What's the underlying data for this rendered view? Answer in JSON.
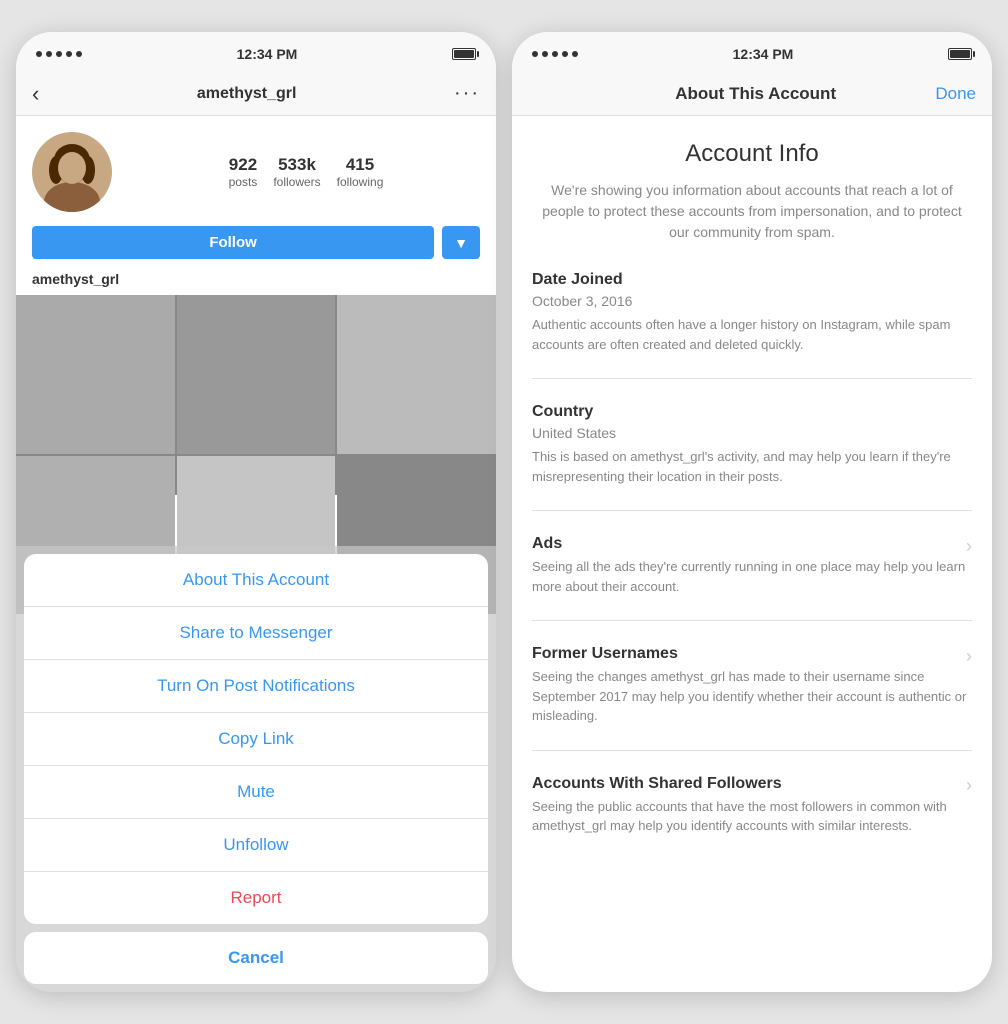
{
  "left_phone": {
    "status_bar": {
      "time": "12:34 PM"
    },
    "nav": {
      "back": "‹",
      "username": "amethyst_grl",
      "more": "···"
    },
    "profile": {
      "stats": [
        {
          "num": "922",
          "label": "posts"
        },
        {
          "num": "533k",
          "label": "followers"
        },
        {
          "num": "415",
          "label": "following"
        }
      ],
      "follow_btn": "Follow",
      "display_name": "amethyst_grl"
    },
    "action_sheet": {
      "items": [
        {
          "label": "About This Account",
          "style": "blue"
        },
        {
          "label": "Share to Messenger",
          "style": "blue"
        },
        {
          "label": "Turn On Post Notifications",
          "style": "blue"
        },
        {
          "label": "Copy Link",
          "style": "blue"
        },
        {
          "label": "Mute",
          "style": "blue"
        },
        {
          "label": "Unfollow",
          "style": "blue"
        },
        {
          "label": "Report",
          "style": "red"
        }
      ],
      "cancel": "Cancel"
    }
  },
  "right_phone": {
    "status_bar": {
      "time": "12:34 PM"
    },
    "nav": {
      "title": "About This Account",
      "done": "Done"
    },
    "account_info": {
      "title": "Account Info",
      "description": "We're showing you information about accounts that reach a lot of people to protect these accounts from impersonation, and to protect our community from spam.",
      "sections": [
        {
          "title": "Date Joined",
          "value": "October 3, 2016",
          "description": "Authentic accounts often have a longer history on Instagram, while spam accounts are often created and deleted quickly.",
          "has_chevron": false
        },
        {
          "title": "Country",
          "value": "United States",
          "description": "This is based on amethyst_grl's activity, and may help you learn if they're misrepresenting their location in their posts.",
          "has_chevron": false
        },
        {
          "title": "Ads",
          "value": "",
          "description": "Seeing all the ads they're currently running in one place may help you learn more about their account.",
          "has_chevron": true
        },
        {
          "title": "Former Usernames",
          "value": "",
          "description": "Seeing the changes amethyst_grl has made to their username since September 2017 may help you identify whether their account is authentic or misleading.",
          "has_chevron": true
        },
        {
          "title": "Accounts With Shared Followers",
          "value": "",
          "description": "Seeing the public accounts that have the most followers in common with amethyst_grl may help you identify accounts with similar interests.",
          "has_chevron": true
        }
      ]
    }
  }
}
